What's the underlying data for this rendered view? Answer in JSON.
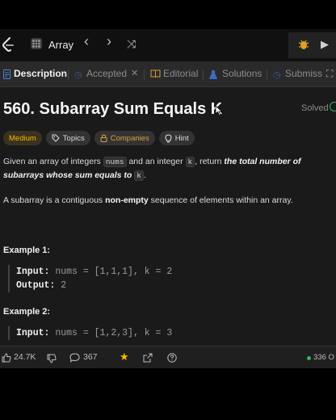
{
  "topbar": {
    "title": "Array",
    "prev_glyph": "‹",
    "next_glyph": "›",
    "shuffle_glyph": "⤨",
    "run_glyph": "▶"
  },
  "tabs": [
    {
      "label": "Description",
      "icon": "document-icon"
    },
    {
      "label": "Accepted",
      "close": "✕"
    },
    {
      "label": "Editorial",
      "icon": "book-icon"
    },
    {
      "label": "Solutions",
      "icon": "flask-icon"
    },
    {
      "label": "Submiss"
    }
  ],
  "problem": {
    "title": "560. Subarray Sum Equals K",
    "status": "Solved"
  },
  "chips": {
    "difficulty": "Medium",
    "topics": "Topics",
    "companies": "Companies",
    "hint": "Hint"
  },
  "description": {
    "p1_a": "Given an array of integers ",
    "p1_code1": "nums",
    "p1_b": " and an integer ",
    "p1_code2": "k",
    "p1_c": ", return ",
    "p1_em": "the total number of subarrays whose sum equals to ",
    "p1_code3": "k",
    "p1_d": ".",
    "p2_a": "A subarray is a contiguous ",
    "p2_strong": "non-empty",
    "p2_b": " sequence of elements within an array."
  },
  "examples": [
    {
      "heading": "Example 1:",
      "input_label": "Input:",
      "input": " nums = [1,1,1], k = 2",
      "output_label": "Output:",
      "output": " 2"
    },
    {
      "heading": "Example 2:",
      "input_label": "Input:",
      "input": " nums = [1,2,3], k = 3"
    }
  ],
  "bottombar": {
    "likes": "24.7K",
    "comments": "367",
    "online": "336 O"
  },
  "colors": {
    "accent_orange": "#ffb800",
    "green": "#2db55d",
    "tab_icon_blue": "#4a7fd8"
  }
}
